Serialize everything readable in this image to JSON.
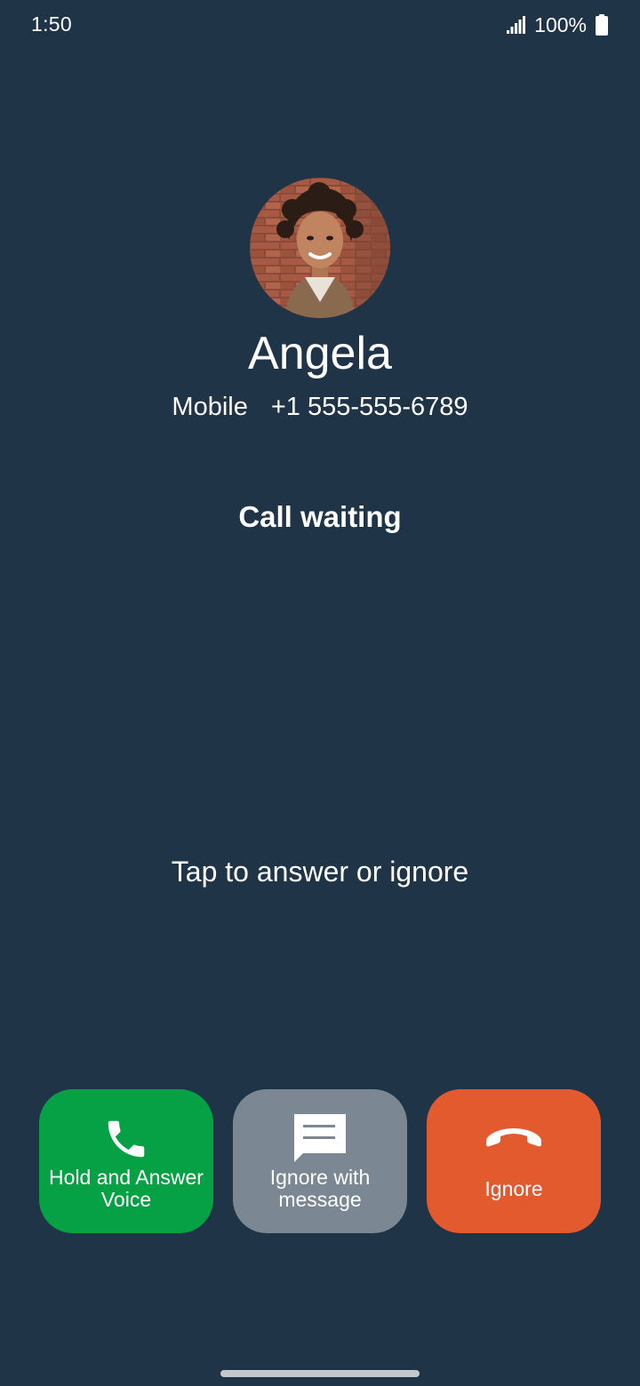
{
  "status_bar": {
    "time": "1:50",
    "battery_percent": "100%",
    "signal_icon": "signal-bars-icon",
    "battery_icon": "battery-full-icon"
  },
  "caller": {
    "name": "Angela",
    "number_type": "Mobile",
    "number": "+1 555-555-6789"
  },
  "call_status": "Call waiting",
  "hint": "Tap to answer or ignore",
  "actions": {
    "answer": {
      "label": "Hold and Answer\nVoice",
      "icon": "phone-icon",
      "color": "#07a145"
    },
    "message": {
      "label": "Ignore with\nmessage",
      "icon": "message-icon",
      "color": "#7b8893"
    },
    "ignore": {
      "label": "Ignore",
      "icon": "hang-up-icon",
      "color": "#e35a2e"
    }
  },
  "colors": {
    "background": "#1f3447"
  }
}
